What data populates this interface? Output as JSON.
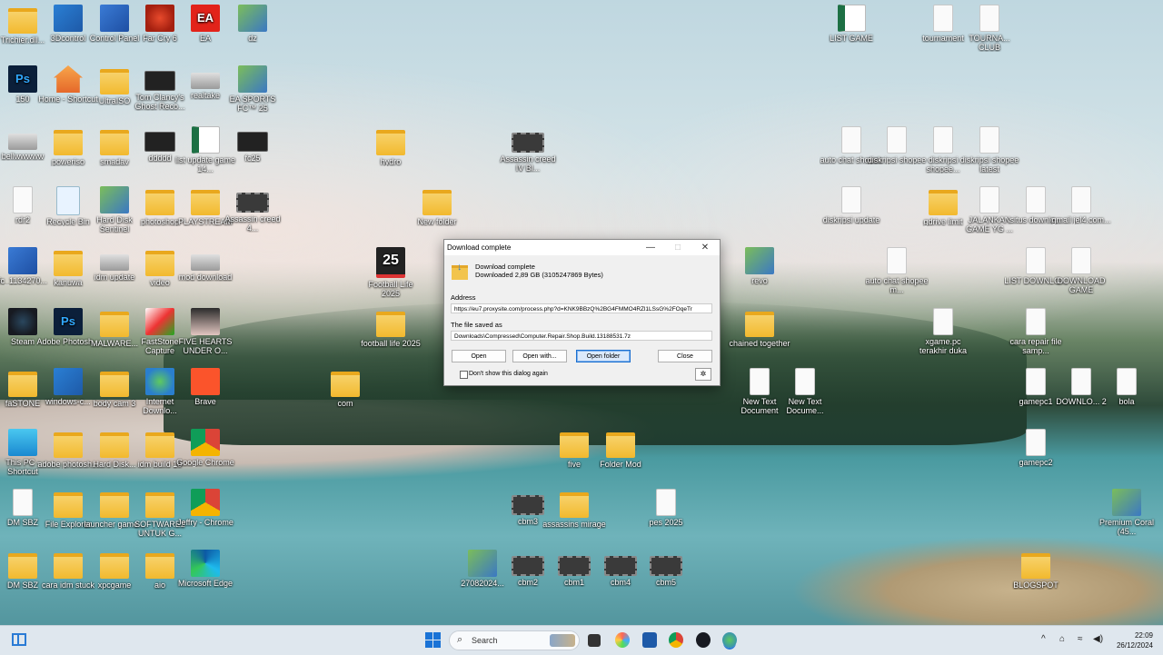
{
  "desktop": {
    "icons": [
      {
        "label": "Trichier.dll...",
        "glyph": "g-folder"
      },
      {
        "label": "3Dcontrol",
        "glyph": "g-win"
      },
      {
        "label": "Control Panel",
        "glyph": "g-app"
      },
      {
        "label": "Far Cry 6",
        "glyph": "g-red"
      },
      {
        "label": "EA",
        "glyph": "g-ea",
        "text": "EA"
      },
      {
        "label": "dz",
        "glyph": "g-img"
      },
      {
        "label": "LIST GAME",
        "glyph": "g-xls"
      },
      {
        "label": "tournament",
        "glyph": "g-file"
      },
      {
        "label": "TOURNA... CLUB",
        "glyph": "g-file"
      },
      {
        "label": "150",
        "glyph": "g-ps",
        "text": "Ps"
      },
      {
        "label": "Home - Shortcut",
        "glyph": "g-home"
      },
      {
        "label": "UltraISO",
        "glyph": "g-folder"
      },
      {
        "label": "Tom Clancy's Ghost Reco...",
        "glyph": "g-dark"
      },
      {
        "label": "realtake",
        "glyph": "g-hdd"
      },
      {
        "label": "EA SPORTS FC™ 25",
        "glyph": "g-img"
      },
      {
        "label": "bellwwwww",
        "glyph": "g-hdd"
      },
      {
        "label": "poweriso",
        "glyph": "g-folder"
      },
      {
        "label": "smadav",
        "glyph": "g-folder"
      },
      {
        "label": "ddddd",
        "glyph": "g-dark"
      },
      {
        "label": "list update game 14...",
        "glyph": "g-xls"
      },
      {
        "label": "fc25",
        "glyph": "g-dark"
      },
      {
        "label": "hydro",
        "glyph": "g-folder"
      },
      {
        "label": "Assassin creed IV Bl...",
        "glyph": "g-video"
      },
      {
        "label": "auto chat shopee",
        "glyph": "g-file"
      },
      {
        "label": "diskripsi shopee",
        "glyph": "g-file"
      },
      {
        "label": "diskripsi shopee...",
        "glyph": "g-file"
      },
      {
        "label": "diskripsi shopee latest",
        "glyph": "g-file"
      },
      {
        "label": "rdr2",
        "glyph": "g-file"
      },
      {
        "label": "Recycle Bin",
        "glyph": "g-recycle"
      },
      {
        "label": "Hard Disk Sentinel",
        "glyph": "g-img"
      },
      {
        "label": "photoshop",
        "glyph": "g-folder"
      },
      {
        "label": "PLAYSTREAM",
        "glyph": "g-folder"
      },
      {
        "label": "Assassin creed 4...",
        "glyph": "g-video"
      },
      {
        "label": "New folder",
        "glyph": "g-folder"
      },
      {
        "label": "diskripsi update",
        "glyph": "g-file"
      },
      {
        "label": "gdrive limit",
        "glyph": "g-folder"
      },
      {
        "label": "JALANKAN GAME YG ...",
        "glyph": "g-file"
      },
      {
        "label": "situs downlo...",
        "glyph": "g-file"
      },
      {
        "label": "gmail jel4.com...",
        "glyph": "g-file"
      },
      {
        "label": "fc_1134270...",
        "glyph": "g-app"
      },
      {
        "label": "kanuwa",
        "glyph": "g-folder"
      },
      {
        "label": "idm update",
        "glyph": "g-hdd"
      },
      {
        "label": "video",
        "glyph": "g-folder"
      },
      {
        "label": "mod download",
        "glyph": "g-hdd"
      },
      {
        "label": "Football Life 2025",
        "glyph": "g-25",
        "text": "25"
      },
      {
        "label": "revo",
        "glyph": "g-img"
      },
      {
        "label": "auto chat shopee m...",
        "glyph": "g-file"
      },
      {
        "label": "LIST DOWNLO...",
        "glyph": "g-file"
      },
      {
        "label": "DOWNLOAD GAME",
        "glyph": "g-file"
      },
      {
        "label": "Steam",
        "glyph": "g-steam"
      },
      {
        "label": "Adobe Photosh...",
        "glyph": "g-ps",
        "text": "Ps"
      },
      {
        "label": "MALWARE...",
        "glyph": "g-folder"
      },
      {
        "label": "FastStone Capture",
        "glyph": "g-fast"
      },
      {
        "label": "FIVE HEARTS UNDER O...",
        "glyph": "g-face"
      },
      {
        "label": "football life 2025",
        "glyph": "g-folder"
      },
      {
        "label": "chained together",
        "glyph": "g-folder"
      },
      {
        "label": "xgame.pc terakhir duka",
        "glyph": "g-file"
      },
      {
        "label": "cara repair file samp...",
        "glyph": "g-file"
      },
      {
        "label": "faSTONE",
        "glyph": "g-folder"
      },
      {
        "label": "windows-c...",
        "glyph": "g-win"
      },
      {
        "label": "body cam 3",
        "glyph": "g-folder"
      },
      {
        "label": "Internet Downlo...",
        "glyph": "g-idm"
      },
      {
        "label": "Brave",
        "glyph": "g-brave"
      },
      {
        "label": "com",
        "glyph": "g-folder"
      },
      {
        "label": "New Text Document",
        "glyph": "g-file"
      },
      {
        "label": "New Text Docume...",
        "glyph": "g-file"
      },
      {
        "label": "gamepc1",
        "glyph": "g-file"
      },
      {
        "label": "DOWNLO... 2",
        "glyph": "g-file"
      },
      {
        "label": "bola",
        "glyph": "g-file"
      },
      {
        "label": "This PC - Shortcut",
        "glyph": "g-pc"
      },
      {
        "label": "adobe photosh...",
        "glyph": "g-folder"
      },
      {
        "label": "Hard Disk...",
        "glyph": "g-folder"
      },
      {
        "label": "idm build 10",
        "glyph": "g-folder"
      },
      {
        "label": "Google Chrome",
        "glyph": "g-chrome"
      },
      {
        "label": "five",
        "glyph": "g-folder"
      },
      {
        "label": "Folder Mod",
        "glyph": "g-folder"
      },
      {
        "label": "gamepc2",
        "glyph": "g-file"
      },
      {
        "label": "DM SBZ",
        "glyph": "g-file"
      },
      {
        "label": "File Explorer",
        "glyph": "g-folder"
      },
      {
        "label": "launcher game...",
        "glyph": "g-folder"
      },
      {
        "label": "SOFTWARE2 UNTUK G...",
        "glyph": "g-folder"
      },
      {
        "label": "Jeffry - Chrome",
        "glyph": "g-chrome"
      },
      {
        "label": "cbm3",
        "glyph": "g-video"
      },
      {
        "label": "assassins mirage",
        "glyph": "g-folder"
      },
      {
        "label": "pes 2025",
        "glyph": "g-file"
      },
      {
        "label": "Premium Coral (45...",
        "glyph": "g-img"
      },
      {
        "label": "DM SBZ",
        "glyph": "g-folder"
      },
      {
        "label": "cara idm stuck",
        "glyph": "g-folder"
      },
      {
        "label": "xpcgame",
        "glyph": "g-folder"
      },
      {
        "label": "aio",
        "glyph": "g-folder"
      },
      {
        "label": "Microsoft Edge",
        "glyph": "g-edge"
      },
      {
        "label": "27082024...",
        "glyph": "g-img"
      },
      {
        "label": "cbm2",
        "glyph": "g-video"
      },
      {
        "label": "cbm1",
        "glyph": "g-video"
      },
      {
        "label": "cbm4",
        "glyph": "g-video"
      },
      {
        "label": "cbm5",
        "glyph": "g-video"
      },
      {
        "label": "BLOGSPOT",
        "glyph": "g-folder"
      }
    ]
  },
  "dialog": {
    "title": "Download complete",
    "status_title": "Download complete",
    "status_size": "Downloaded 2,89  GB (3105247869 Bytes)",
    "address_label": "Address",
    "address_value": "https://eu7.proxysite.com/process.php?d=KNK9BBzQ%2BG4FMMO4RZl1LSsG%2FOqeTr",
    "saved_label": "The file saved as",
    "saved_value": "Downloads\\Compressed\\Computer.Repair.Shop.Build.13188531.7z",
    "buttons": {
      "open": "Open",
      "open_with": "Open with...",
      "open_folder": "Open folder",
      "close": "Close"
    },
    "checkbox_label": "Don't show this dialog again",
    "minimize": "—",
    "maximize": "□",
    "close_x": "✕"
  },
  "taskbar": {
    "search_placeholder": "Search",
    "time": "22:09",
    "date": "26/12/2024",
    "tray": {
      "chevron": "^",
      "network": "⌂",
      "wifi": "≈",
      "volume": "◀)"
    }
  }
}
